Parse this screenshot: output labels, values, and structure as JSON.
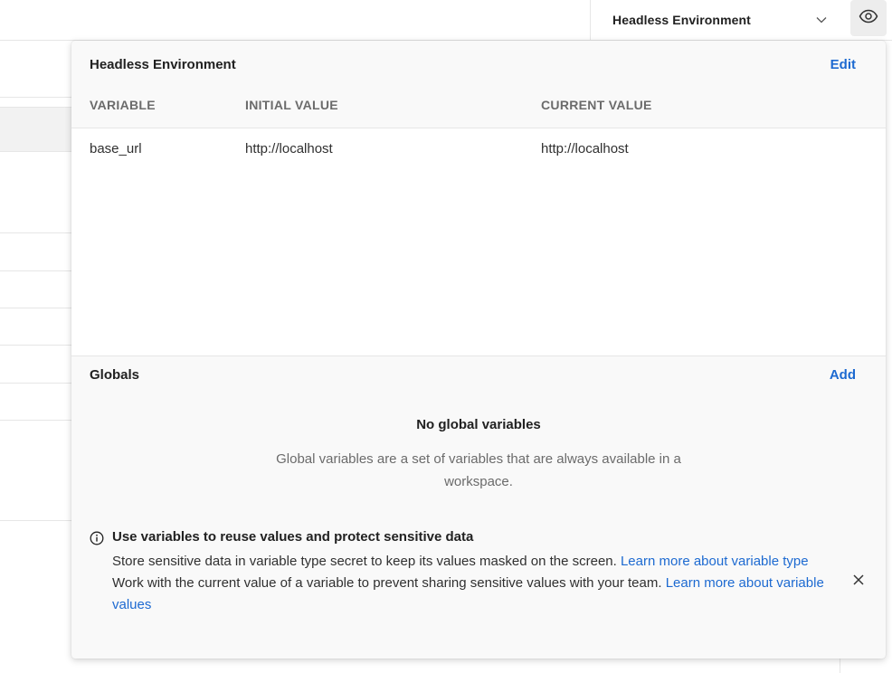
{
  "environment": {
    "selected": "Headless Environment",
    "dropdown_icon": "chevron-down-icon",
    "quick_look_icon": "eye-icon"
  },
  "popover": {
    "env_section": {
      "title": "Headless Environment",
      "edit_label": "Edit",
      "columns": [
        "VARIABLE",
        "INITIAL VALUE",
        "CURRENT VALUE"
      ],
      "rows": [
        {
          "variable": "base_url",
          "initial_value": "http://localhost",
          "current_value": "http://localhost"
        }
      ]
    },
    "globals_section": {
      "title": "Globals",
      "add_label": "Add",
      "empty_title": "No global variables",
      "empty_description": "Global variables are a set of variables that are always available in a workspace."
    },
    "info": {
      "icon": "info-icon",
      "title": "Use variables to reuse values and protect sensitive data",
      "line1_text": "Store sensitive data in variable type secret to keep its values masked on the screen. ",
      "line1_link": "Learn more about variable type",
      "line2_text": "Work with the current value of a variable to prevent sharing sensitive values with your team. ",
      "line2_link": "Learn more about variable values",
      "close_icon": "close-icon"
    }
  },
  "colors": {
    "accent_link": "#1d6ad1",
    "popover_bg": "#f9f9f9",
    "muted_text": "#6b6b6b"
  }
}
